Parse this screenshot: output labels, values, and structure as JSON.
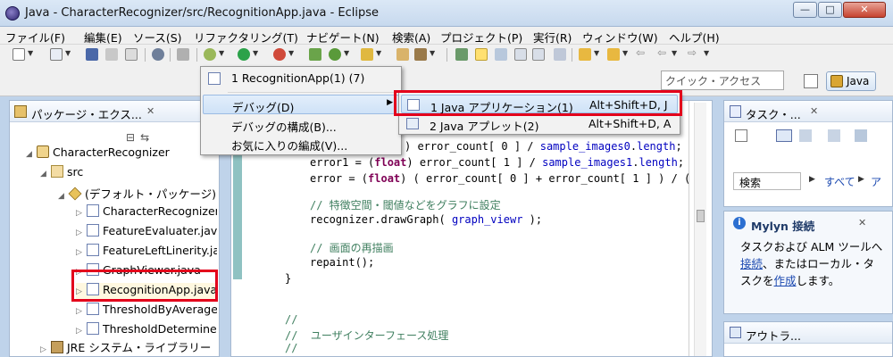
{
  "window": {
    "title": "Java - CharacterRecognizer/src/RecognitionApp.java - Eclipse"
  },
  "menubar": [
    "ファイル(F)",
    "編集(E)",
    "ソース(S)",
    "リファクタリング(T)",
    "ナビゲート(N)",
    "検索(A)",
    "プロジェクト(P)",
    "実行(R)",
    "ウィンドウ(W)",
    "ヘルプ(H)"
  ],
  "quick_access": {
    "placeholder": "クイック・アクセス"
  },
  "perspective": {
    "label": "Java"
  },
  "package_explorer": {
    "title": "パッケージ・エクス...",
    "tree": [
      {
        "label": "CharacterRecognizer",
        "icon": "project-icon"
      },
      {
        "label": "src",
        "icon": "source-folder-icon"
      },
      {
        "label": "(デフォルト・パッケージ)",
        "icon": "package-icon"
      },
      {
        "label": "CharacterRecognizer.java",
        "icon": "java-file-icon"
      },
      {
        "label": "FeatureEvaluater.java",
        "icon": "java-file-icon"
      },
      {
        "label": "FeatureLeftLinerity.java",
        "icon": "java-file-icon"
      },
      {
        "label": "GraphViewer.java",
        "icon": "java-file-icon"
      },
      {
        "label": "RecognitionApp.java",
        "icon": "java-file-icon"
      },
      {
        "label": "ThresholdByAverage.java",
        "icon": "java-file-icon"
      },
      {
        "label": "ThresholdDetermine.java",
        "icon": "java-file-icon"
      },
      {
        "label": "JRE システム・ライブラリー",
        "icon": "jre-library-icon"
      }
    ]
  },
  "editor": {
    "lines": [
      {
        "segs": [
          [
            "n",
            ") error_count[ 0 ] / "
          ],
          [
            "f",
            "sample_images0"
          ],
          [
            "n",
            "."
          ],
          [
            "f",
            "length"
          ],
          [
            "n",
            ";"
          ]
        ]
      },
      {
        "segs": [
          [
            "n",
            "error1 = ("
          ],
          [
            "k",
            "float"
          ],
          [
            "n",
            ") error_count[ 1 ] / "
          ],
          [
            "f",
            "sample_images1"
          ],
          [
            "n",
            "."
          ],
          [
            "f",
            "length"
          ],
          [
            "n",
            ";"
          ]
        ]
      },
      {
        "segs": [
          [
            "n",
            "error = ("
          ],
          [
            "k",
            "float"
          ],
          [
            "n",
            ") ( error_count[ 0 ] + error_count[ 1 ] ) / ("
          ]
        ]
      },
      {
        "segs": [
          [
            "c",
            "// 特徴空間・閾値などをグラフに設定"
          ]
        ]
      },
      {
        "segs": [
          [
            "n",
            "recognizer.drawGraph( "
          ],
          [
            "f",
            "graph_viewr"
          ],
          [
            "n",
            " );"
          ]
        ]
      },
      {
        "segs": [
          [
            "c",
            "// 画面の再描画"
          ]
        ]
      },
      {
        "segs": [
          [
            "n",
            "repaint();"
          ]
        ]
      },
      {
        "segs": [
          [
            "n",
            "}"
          ]
        ]
      },
      {
        "segs": [
          [
            "c",
            "//"
          ]
        ]
      },
      {
        "segs": [
          [
            "c",
            "//  ユーザインターフェース処理"
          ]
        ]
      },
      {
        "segs": [
          [
            "c",
            "//"
          ]
        ]
      }
    ]
  },
  "debug_menu": {
    "items": [
      {
        "label": "1 RecognitionApp(1) (7)"
      },
      {
        "label": "デバッグ(D)"
      },
      {
        "label": "デバッグの構成(B)..."
      },
      {
        "label": "お気に入りの編成(V)..."
      }
    ]
  },
  "debug_submenu": {
    "items": [
      {
        "label": "1 Java アプリケーション(1)",
        "accel": "Alt+Shift+D, J"
      },
      {
        "label": "2 Java アプレット(2)",
        "accel": "Alt+Shift+D, A"
      }
    ]
  },
  "task_list": {
    "title": "タスク・...",
    "search": "検索",
    "all": "すべて",
    "more": "ア"
  },
  "mylyn": {
    "title": "Mylyn 接続",
    "t1": "タスクおよび ALM ツールへ",
    "link1": "接続",
    "t2": "、またはローカル・タスクを",
    "link2": "作成",
    "t3": "します。"
  },
  "outline": {
    "title": "アウトラ..."
  },
  "colors": {
    "highlight_box": "#e3001b",
    "keyword": "#7f0055",
    "field": "#0000c0",
    "comment": "#3f7f5f"
  }
}
